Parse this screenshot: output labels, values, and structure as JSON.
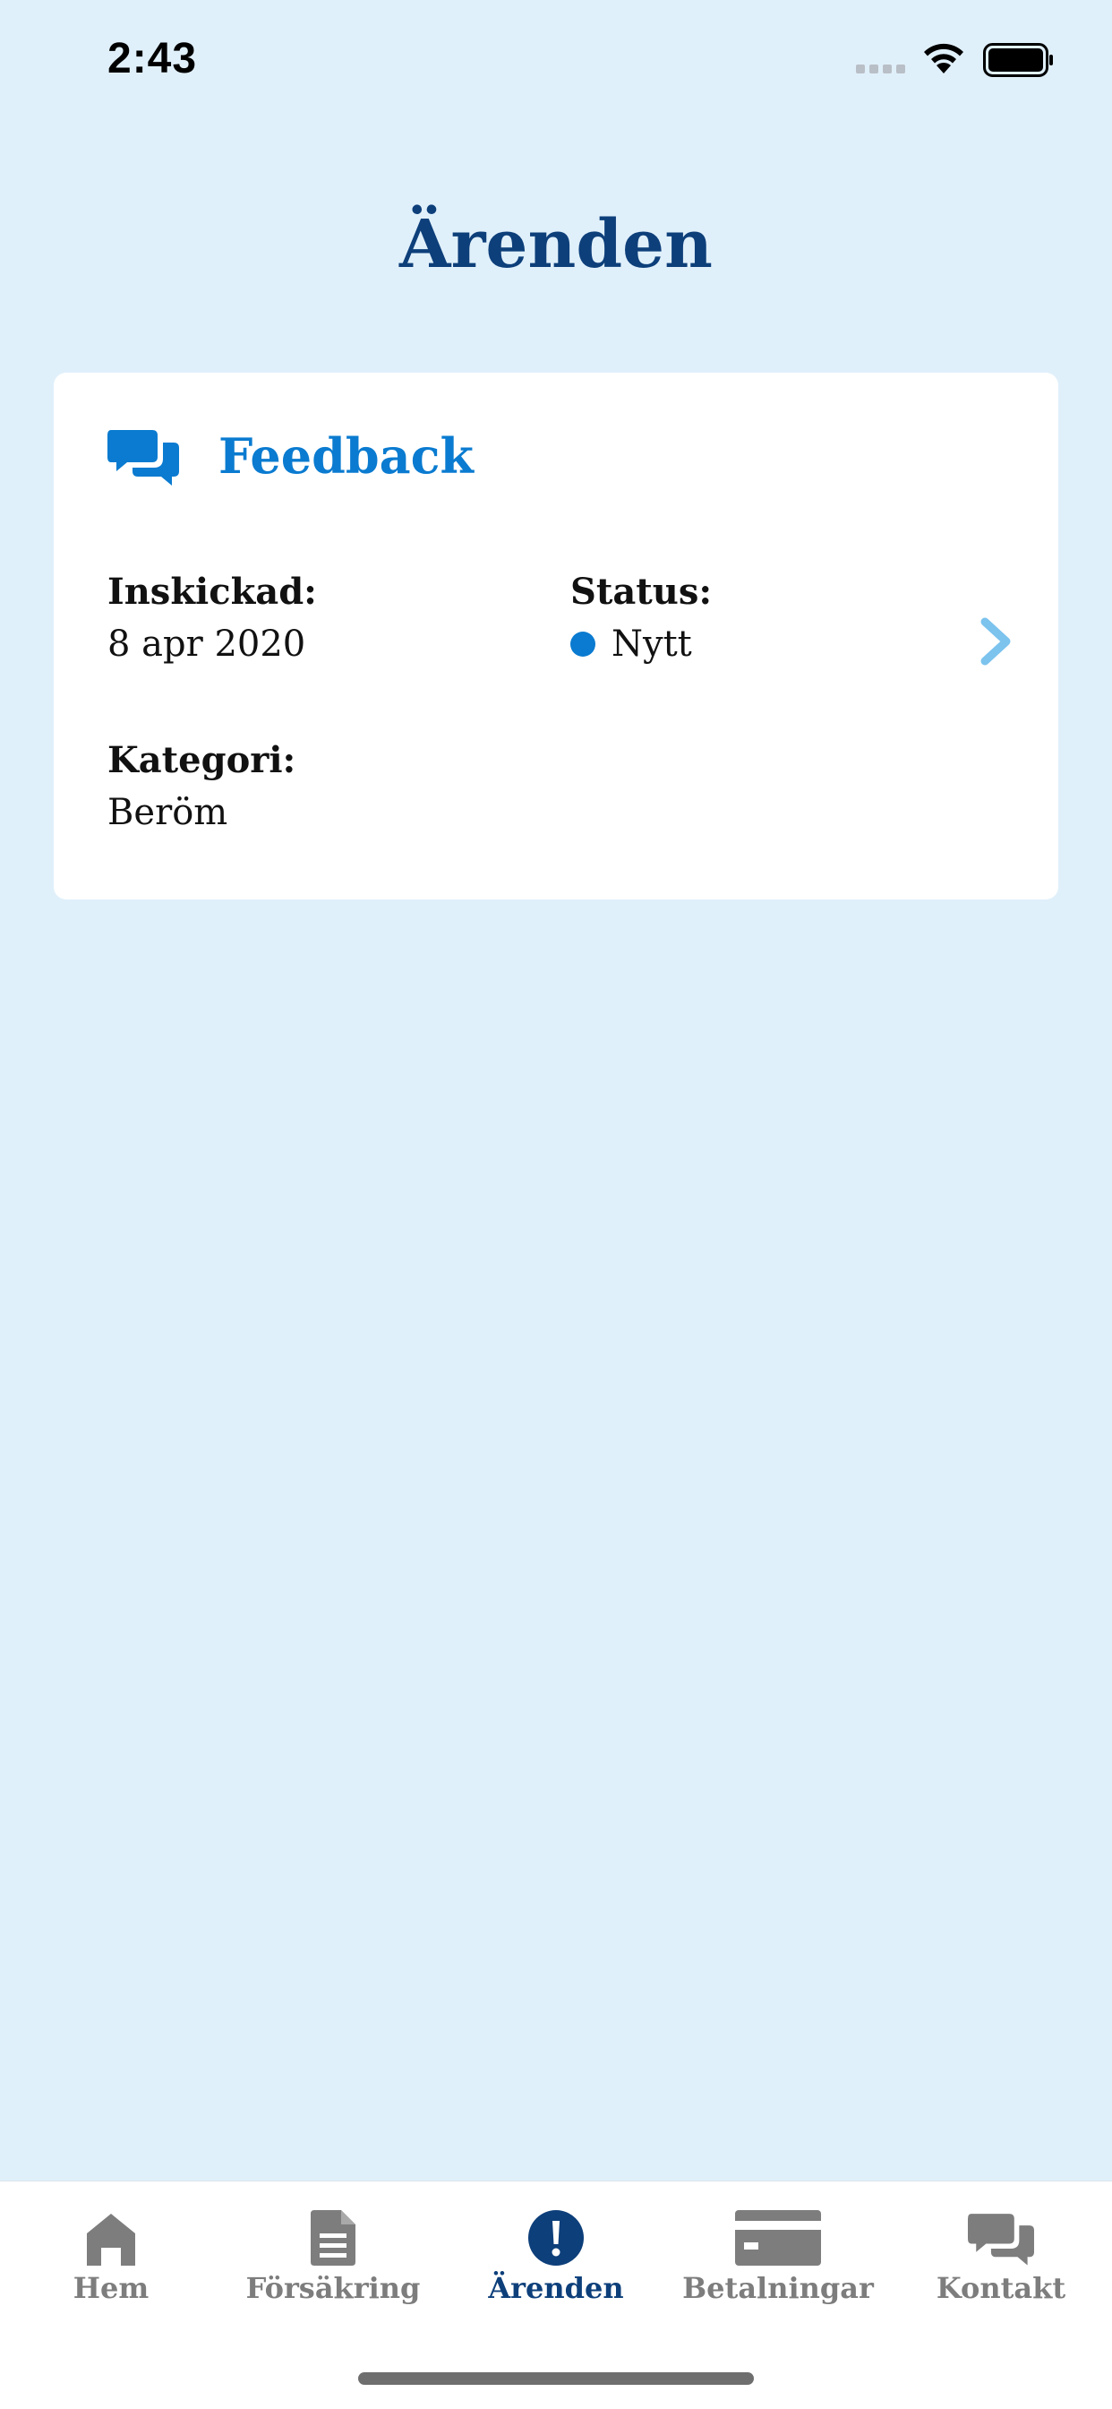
{
  "status_bar": {
    "time": "2:43"
  },
  "page": {
    "title": "Ärenden"
  },
  "card": {
    "icon": "chat-bubbles-icon",
    "title": "Feedback",
    "submitted_label": "Inskickad:",
    "submitted_value": "8 apr 2020",
    "status_label": "Status:",
    "status_value": "Nytt",
    "status_color": "#0a7bd0",
    "category_label": "Kategori:",
    "category_value": "Beröm"
  },
  "tab_bar": {
    "active_color": "#0d3f7a",
    "inactive_color": "#7d7d7d",
    "tabs": [
      {
        "label": "Hem",
        "icon": "home-icon",
        "active": false
      },
      {
        "label": "Försäkring",
        "icon": "document-icon",
        "active": false
      },
      {
        "label": "Ärenden",
        "icon": "exclamation-icon",
        "active": true
      },
      {
        "label": "Betalningar",
        "icon": "credit-card-icon",
        "active": false
      },
      {
        "label": "Kontakt",
        "icon": "chat-bubbles-icon",
        "active": false
      }
    ]
  },
  "colors": {
    "background": "#e0f0fb",
    "title": "#0d3f7a",
    "accent": "#0a7bd0",
    "chevron": "#7cc3ee"
  }
}
